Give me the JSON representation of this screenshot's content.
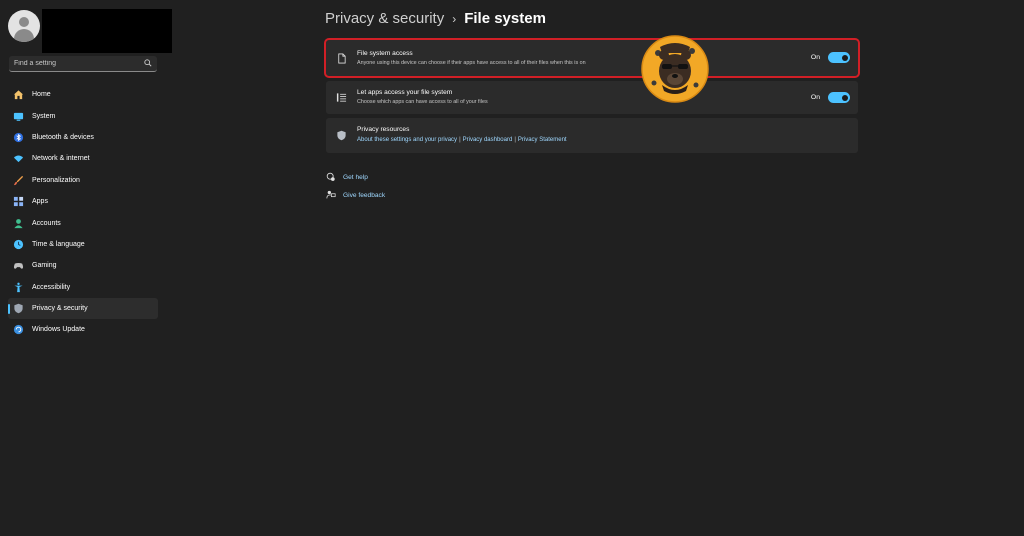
{
  "sidebar": {
    "search": {
      "placeholder": "Find a setting"
    },
    "items": [
      {
        "label": "Home",
        "icon": "home-icon",
        "color": "#f3c26b"
      },
      {
        "label": "System",
        "icon": "system-icon",
        "color": "#4cc2ff"
      },
      {
        "label": "Bluetooth & devices",
        "icon": "bluetooth-icon",
        "color": "#4c8dff"
      },
      {
        "label": "Network & internet",
        "icon": "network-icon",
        "color": "#4cc2ff"
      },
      {
        "label": "Personalization",
        "icon": "brush-icon",
        "color": "#f0a04b"
      },
      {
        "label": "Apps",
        "icon": "apps-icon",
        "color": "#8ab4f8"
      },
      {
        "label": "Accounts",
        "icon": "accounts-icon",
        "color": "#3fbf8f"
      },
      {
        "label": "Time & language",
        "icon": "time-language-icon",
        "color": "#4cc2ff"
      },
      {
        "label": "Gaming",
        "icon": "gaming-icon",
        "color": "#c0c0c0"
      },
      {
        "label": "Accessibility",
        "icon": "accessibility-icon",
        "color": "#4cc2ff"
      },
      {
        "label": "Privacy & security",
        "icon": "shield-icon",
        "color": "#9ea7b3",
        "active": true
      },
      {
        "label": "Windows Update",
        "icon": "windows-update-icon",
        "color": "#3a8fe0"
      }
    ]
  },
  "header": {
    "parent": "Privacy & security",
    "separator": "›",
    "current": "File system"
  },
  "cards": {
    "file_system_access": {
      "title": "File system access",
      "subtitle": "Anyone using this device can choose if their apps have access to all of their files when this is on",
      "state": "On",
      "toggle_on": true
    },
    "let_apps_access": {
      "title": "Let apps access your file system",
      "subtitle": "Choose which apps can have access to all of your files",
      "state": "On",
      "toggle_on": true
    },
    "privacy_resources": {
      "title": "Privacy resources",
      "links": [
        "About these settings and your privacy",
        "Privacy dashboard",
        "Privacy Statement"
      ],
      "separator": "|"
    }
  },
  "help": {
    "get_help": "Get help",
    "give_feedback": "Give feedback"
  },
  "colors": {
    "accent": "#4cc2ff",
    "highlight_border": "#d11f26",
    "background": "#202020",
    "card": "#2b2b2b"
  }
}
